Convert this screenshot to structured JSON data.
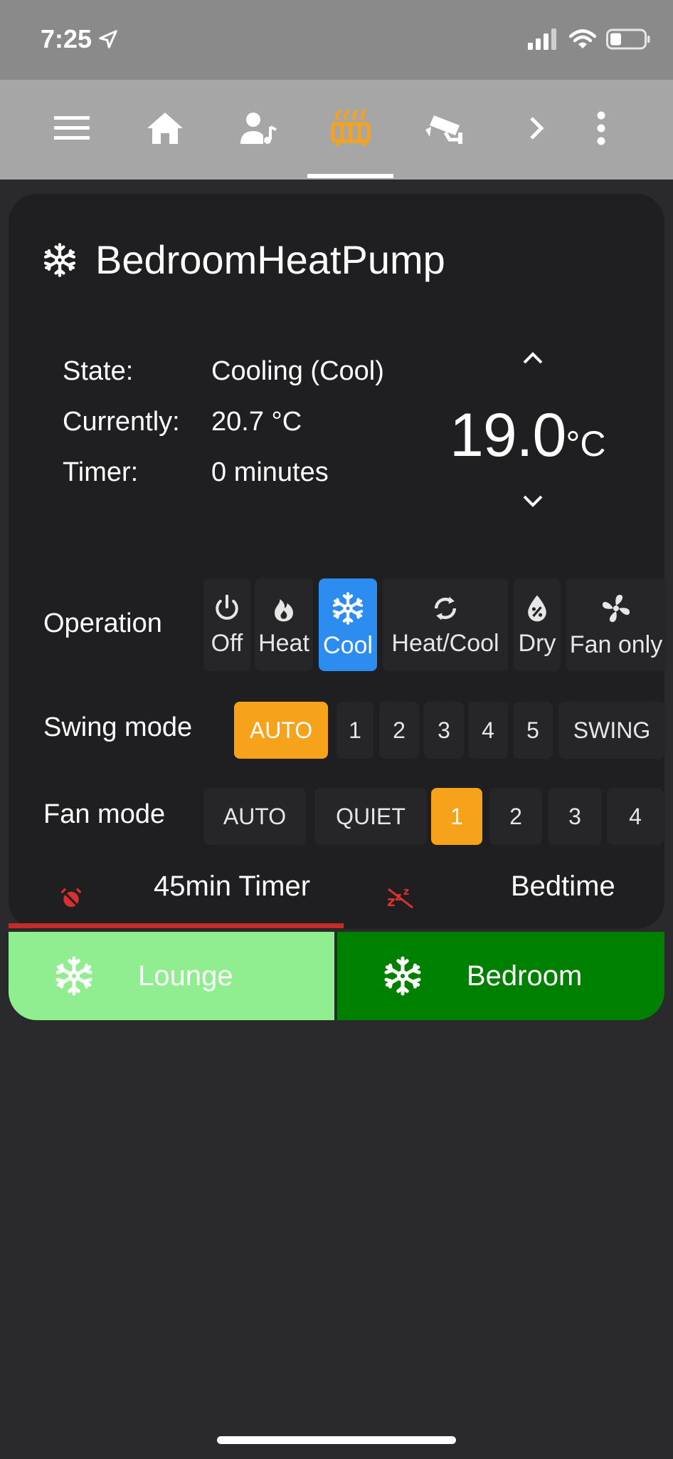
{
  "statusbar": {
    "time": "7:25"
  },
  "toolbar": {
    "icons": [
      "menu-icon",
      "home-icon",
      "person-music-icon",
      "radiator-icon",
      "cctv-icon",
      "chevron-right-icon",
      "more-vertical-icon"
    ],
    "active_index": 3,
    "active_color": "#f7a21b"
  },
  "card": {
    "title": "BedroomHeatPump",
    "info": {
      "state_label": "State:",
      "state_value": "Cooling (Cool)",
      "currently_label": "Currently:",
      "currently_value": "20.7 °C",
      "timer_label": "Timer:",
      "timer_value": "0 minutes"
    },
    "setpoint": {
      "value": "19.0",
      "unit": "°C"
    },
    "operation": {
      "label": "Operation",
      "options": [
        "Off",
        "Heat",
        "Cool",
        "Heat/Cool",
        "Dry",
        "Fan only"
      ],
      "selected": "Cool"
    },
    "swing": {
      "label": "Swing mode",
      "options": [
        "AUTO",
        "1",
        "2",
        "3",
        "4",
        "5",
        "SWING"
      ],
      "selected": "AUTO"
    },
    "fan": {
      "label": "Fan mode",
      "options": [
        "AUTO",
        "QUIET",
        "1",
        "2",
        "3",
        "4"
      ],
      "selected": "1"
    },
    "footer": {
      "timer_tab": "45min Timer",
      "bedtime_tab": "Bedtime"
    }
  },
  "rooms": {
    "lounge": {
      "label": "Lounge",
      "color": "#90ee90"
    },
    "bedroom": {
      "label": "Bedroom",
      "color": "#008000"
    }
  },
  "colors": {
    "accent_blue": "#2d8cf0",
    "accent_orange": "#f7a21b",
    "alert_red": "#c42b2b"
  }
}
